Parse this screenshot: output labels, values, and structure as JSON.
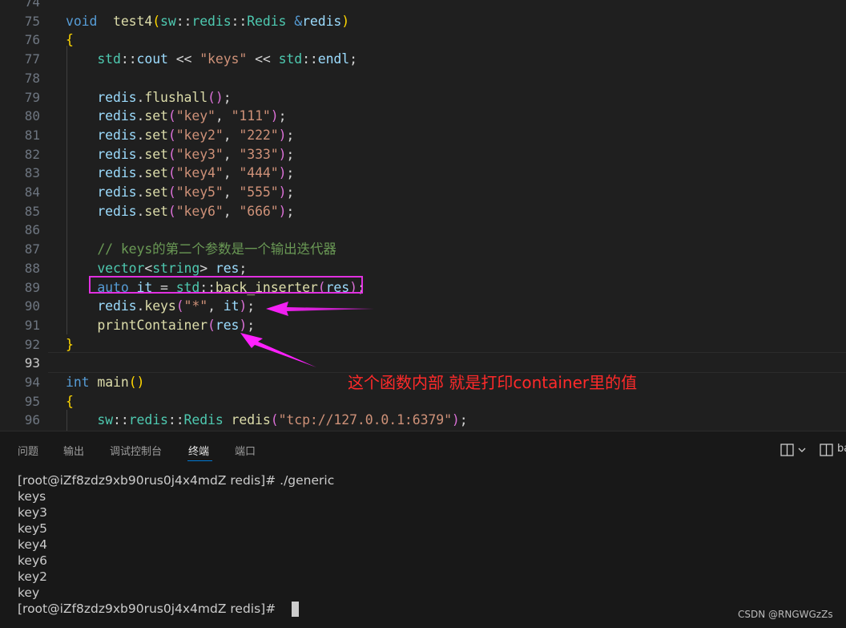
{
  "editor": {
    "line_numbers": [
      "74",
      "75",
      "76",
      "77",
      "78",
      "79",
      "80",
      "81",
      "82",
      "83",
      "84",
      "85",
      "86",
      "87",
      "88",
      "89",
      "90",
      "91",
      "92",
      "93",
      "94",
      "95",
      "96"
    ],
    "active_line": "93",
    "lines": [
      [],
      [
        [
          "kw",
          "void"
        ],
        [
          "",
          "  "
        ],
        [
          "fn",
          "test4"
        ],
        [
          "p1",
          "("
        ],
        [
          "ty",
          "sw"
        ],
        [
          "",
          "::"
        ],
        [
          "ty",
          "redis"
        ],
        [
          "",
          "::"
        ],
        [
          "ty",
          "Redis"
        ],
        [
          "",
          " "
        ],
        [
          "kw",
          "&"
        ],
        [
          "var",
          "redis"
        ],
        [
          "p1",
          ")"
        ]
      ],
      [
        [
          "p1",
          "{"
        ]
      ],
      [
        [
          "",
          "    "
        ],
        [
          "ty",
          "std"
        ],
        [
          "",
          "::"
        ],
        [
          "var",
          "cout"
        ],
        [
          "",
          " << "
        ],
        [
          "str",
          "\"keys\""
        ],
        [
          "",
          " << "
        ],
        [
          "ty",
          "std"
        ],
        [
          "",
          "::"
        ],
        [
          "var",
          "endl"
        ],
        [
          "",
          ";"
        ]
      ],
      [],
      [
        [
          "",
          "    "
        ],
        [
          "var",
          "redis"
        ],
        [
          "",
          "."
        ],
        [
          "fn",
          "flushall"
        ],
        [
          "p2",
          "()"
        ],
        [
          "",
          ";"
        ]
      ],
      [
        [
          "",
          "    "
        ],
        [
          "var",
          "redis"
        ],
        [
          "",
          "."
        ],
        [
          "fn",
          "set"
        ],
        [
          "p2",
          "("
        ],
        [
          "str",
          "\"key\""
        ],
        [
          "",
          ", "
        ],
        [
          "str",
          "\"111\""
        ],
        [
          "p2",
          ")"
        ],
        [
          "",
          ";"
        ]
      ],
      [
        [
          "",
          "    "
        ],
        [
          "var",
          "redis"
        ],
        [
          "",
          "."
        ],
        [
          "fn",
          "set"
        ],
        [
          "p2",
          "("
        ],
        [
          "str",
          "\"key2\""
        ],
        [
          "",
          ", "
        ],
        [
          "str",
          "\"222\""
        ],
        [
          "p2",
          ")"
        ],
        [
          "",
          ";"
        ]
      ],
      [
        [
          "",
          "    "
        ],
        [
          "var",
          "redis"
        ],
        [
          "",
          "."
        ],
        [
          "fn",
          "set"
        ],
        [
          "p2",
          "("
        ],
        [
          "str",
          "\"key3\""
        ],
        [
          "",
          ", "
        ],
        [
          "str",
          "\"333\""
        ],
        [
          "p2",
          ")"
        ],
        [
          "",
          ";"
        ]
      ],
      [
        [
          "",
          "    "
        ],
        [
          "var",
          "redis"
        ],
        [
          "",
          "."
        ],
        [
          "fn",
          "set"
        ],
        [
          "p2",
          "("
        ],
        [
          "str",
          "\"key4\""
        ],
        [
          "",
          ", "
        ],
        [
          "str",
          "\"444\""
        ],
        [
          "p2",
          ")"
        ],
        [
          "",
          ";"
        ]
      ],
      [
        [
          "",
          "    "
        ],
        [
          "var",
          "redis"
        ],
        [
          "",
          "."
        ],
        [
          "fn",
          "set"
        ],
        [
          "p2",
          "("
        ],
        [
          "str",
          "\"key5\""
        ],
        [
          "",
          ", "
        ],
        [
          "str",
          "\"555\""
        ],
        [
          "p2",
          ")"
        ],
        [
          "",
          ";"
        ]
      ],
      [
        [
          "",
          "    "
        ],
        [
          "var",
          "redis"
        ],
        [
          "",
          "."
        ],
        [
          "fn",
          "set"
        ],
        [
          "p2",
          "("
        ],
        [
          "str",
          "\"key6\""
        ],
        [
          "",
          ", "
        ],
        [
          "str",
          "\"666\""
        ],
        [
          "p2",
          ")"
        ],
        [
          "",
          ";"
        ]
      ],
      [],
      [
        [
          "",
          "    "
        ],
        [
          "com",
          "// keys的第二个参数是一个输出迭代器"
        ]
      ],
      [
        [
          "",
          "    "
        ],
        [
          "ty",
          "vector"
        ],
        [
          "",
          "<"
        ],
        [
          "ty",
          "string"
        ],
        [
          "",
          "> "
        ],
        [
          "var",
          "res"
        ],
        [
          "",
          ";"
        ]
      ],
      [
        [
          "",
          "    "
        ],
        [
          "kw",
          "auto"
        ],
        [
          "",
          " "
        ],
        [
          "var",
          "it"
        ],
        [
          "",
          " = "
        ],
        [
          "ty",
          "std"
        ],
        [
          "",
          "::"
        ],
        [
          "fn",
          "back_inserter"
        ],
        [
          "p2",
          "("
        ],
        [
          "var",
          "res"
        ],
        [
          "p2",
          ")"
        ],
        [
          "",
          ";"
        ]
      ],
      [
        [
          "",
          "    "
        ],
        [
          "var",
          "redis"
        ],
        [
          "",
          "."
        ],
        [
          "fn",
          "keys"
        ],
        [
          "p2",
          "("
        ],
        [
          "str",
          "\"*\""
        ],
        [
          "",
          ", "
        ],
        [
          "var",
          "it"
        ],
        [
          "p2",
          ")"
        ],
        [
          "",
          ";"
        ]
      ],
      [
        [
          "",
          "    "
        ],
        [
          "fn",
          "printContainer"
        ],
        [
          "p2",
          "("
        ],
        [
          "var",
          "res"
        ],
        [
          "p2",
          ")"
        ],
        [
          "",
          ";"
        ]
      ],
      [
        [
          "p1",
          "}"
        ]
      ],
      [],
      [
        [
          "kw",
          "int"
        ],
        [
          "",
          " "
        ],
        [
          "fn",
          "main"
        ],
        [
          "p1",
          "()"
        ]
      ],
      [
        [
          "p1",
          "{"
        ]
      ],
      [
        [
          "",
          "    "
        ],
        [
          "ty",
          "sw"
        ],
        [
          "",
          "::"
        ],
        [
          "ty",
          "redis"
        ],
        [
          "",
          "::"
        ],
        [
          "ty",
          "Redis"
        ],
        [
          "",
          " "
        ],
        [
          "fn",
          "redis"
        ],
        [
          "p2",
          "("
        ],
        [
          "str",
          "\"tcp://127.0.0.1:6379\""
        ],
        [
          "p2",
          ")"
        ],
        [
          "",
          ";"
        ]
      ]
    ]
  },
  "annotation": {
    "text": "这个函数内部 就是打印container里的值",
    "color": "#ff2a2a",
    "box_color": "#e030e0"
  },
  "panel": {
    "tabs": [
      "问题",
      "输出",
      "调试控制台",
      "终端",
      "端口"
    ],
    "active_tab": "终端",
    "right_label": "ba",
    "icons": [
      "split-editor-icon",
      "chevron-down-icon",
      "split-terminal-icon"
    ]
  },
  "terminal": {
    "lines": [
      "[root@iZf8zdz9xb90rus0j4x4mdZ redis]# ./generic",
      "keys",
      "key3",
      "key5",
      "key4",
      "key6",
      "key2",
      "key",
      "[root@iZf8zdz9xb90rus0j4x4mdZ redis]# "
    ]
  },
  "watermark": "CSDN @RNGWGzZs"
}
